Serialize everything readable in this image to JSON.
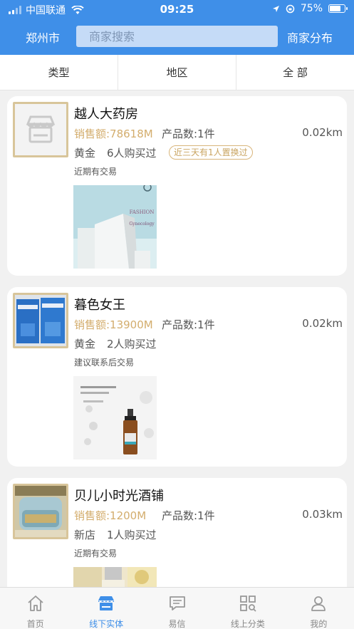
{
  "status_bar": {
    "carrier": "中国联通",
    "time": "09:25",
    "battery": "75%",
    "battery_level": 0.75
  },
  "header": {
    "city": "郑州市",
    "search_placeholder": "商家搜索",
    "distribution_link": "商家分布"
  },
  "filters": [
    {
      "label": "类型"
    },
    {
      "label": "地区"
    },
    {
      "label": "全 部"
    }
  ],
  "stores": [
    {
      "name": "越人大药房",
      "sales": "销售额:78618M",
      "products": "产品数:1件",
      "distance": "0.02km",
      "level": "黄金",
      "buyers": "6人购买过",
      "badge": "近三天有1人置换过",
      "note": "近期有交易",
      "photo_text_1": "FASHION",
      "photo_text_2": "Gynecology"
    },
    {
      "name": "暮色女王",
      "sales": "销售额:13900M",
      "products": "产品数:1件",
      "distance": "0.02km",
      "level": "黄金",
      "buyers": "2人购买过",
      "note": "建议联系后交易"
    },
    {
      "name": "贝儿小时光酒铺",
      "sales": "销售额:1200M",
      "products": "产品数:1件",
      "distance": "0.03km",
      "level": "新店",
      "buyers": "1人购买过",
      "note": "近期有交易"
    }
  ],
  "tabbar": [
    {
      "label": "首页",
      "icon": "home-icon"
    },
    {
      "label": "线下实体",
      "icon": "store-icon"
    },
    {
      "label": "易信",
      "icon": "message-icon"
    },
    {
      "label": "线上分类",
      "icon": "category-icon"
    },
    {
      "label": "我的",
      "icon": "profile-icon"
    }
  ],
  "colors": {
    "primary": "#3f8fe8",
    "gold": "#d3ad6d",
    "background": "#f1f1f1"
  }
}
